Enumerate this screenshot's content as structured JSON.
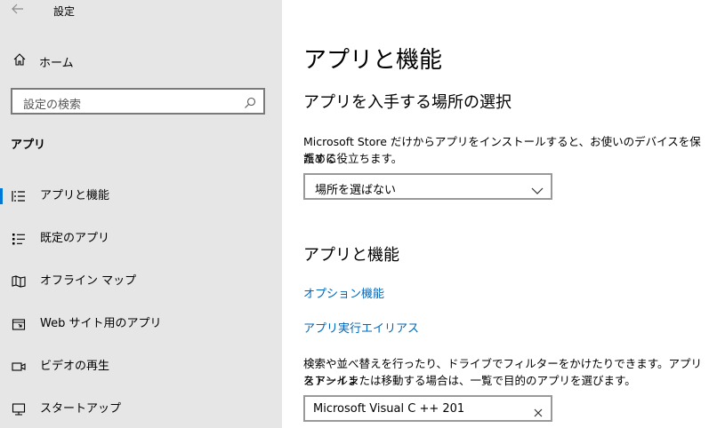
{
  "window": {
    "title": "設定",
    "back_icon": "back-arrow-icon"
  },
  "sidebar": {
    "home_label": "ホーム",
    "search_placeholder": "設定の検索",
    "section_title": "アプリ",
    "items": [
      {
        "label": "アプリと機能",
        "icon": "apps-list-icon",
        "selected": true
      },
      {
        "label": "既定のアプリ",
        "icon": "default-apps-icon",
        "selected": false
      },
      {
        "label": "オフライン マップ",
        "icon": "offline-maps-icon",
        "selected": false
      },
      {
        "label": "Web サイト用のアプリ",
        "icon": "apps-for-websites-icon",
        "selected": false
      },
      {
        "label": "ビデオの再生",
        "icon": "video-playback-icon",
        "selected": false
      },
      {
        "label": "スタートアップ",
        "icon": "startup-icon",
        "selected": false
      }
    ]
  },
  "main": {
    "page_title": "アプリと機能",
    "install_section": {
      "heading": "アプリを入手する場所の選択",
      "description_line1": "Microsoft Store だけからアプリをインストールすると、お使いのデバイスを保護する",
      "description_line2": "ために役立ちます。",
      "dropdown_value": "場所を選ばない"
    },
    "apps_section": {
      "heading": "アプリと機能",
      "link_optional_features": "オプション機能",
      "link_app_aliases": "アプリ実行エイリアス",
      "description_line1": "検索や並べ替えを行ったり、ドライブでフィルターをかけたりできます。アプリをアンイン",
      "description_line2": "ストールまたは移動する場合は、一覧で目的のアプリを選びます。",
      "search_value": "Microsoft Visual C ++ 201"
    }
  },
  "colors": {
    "accent": "#0078d7",
    "link": "#0067b8",
    "sidebar_bg": "#e6e6e6"
  }
}
